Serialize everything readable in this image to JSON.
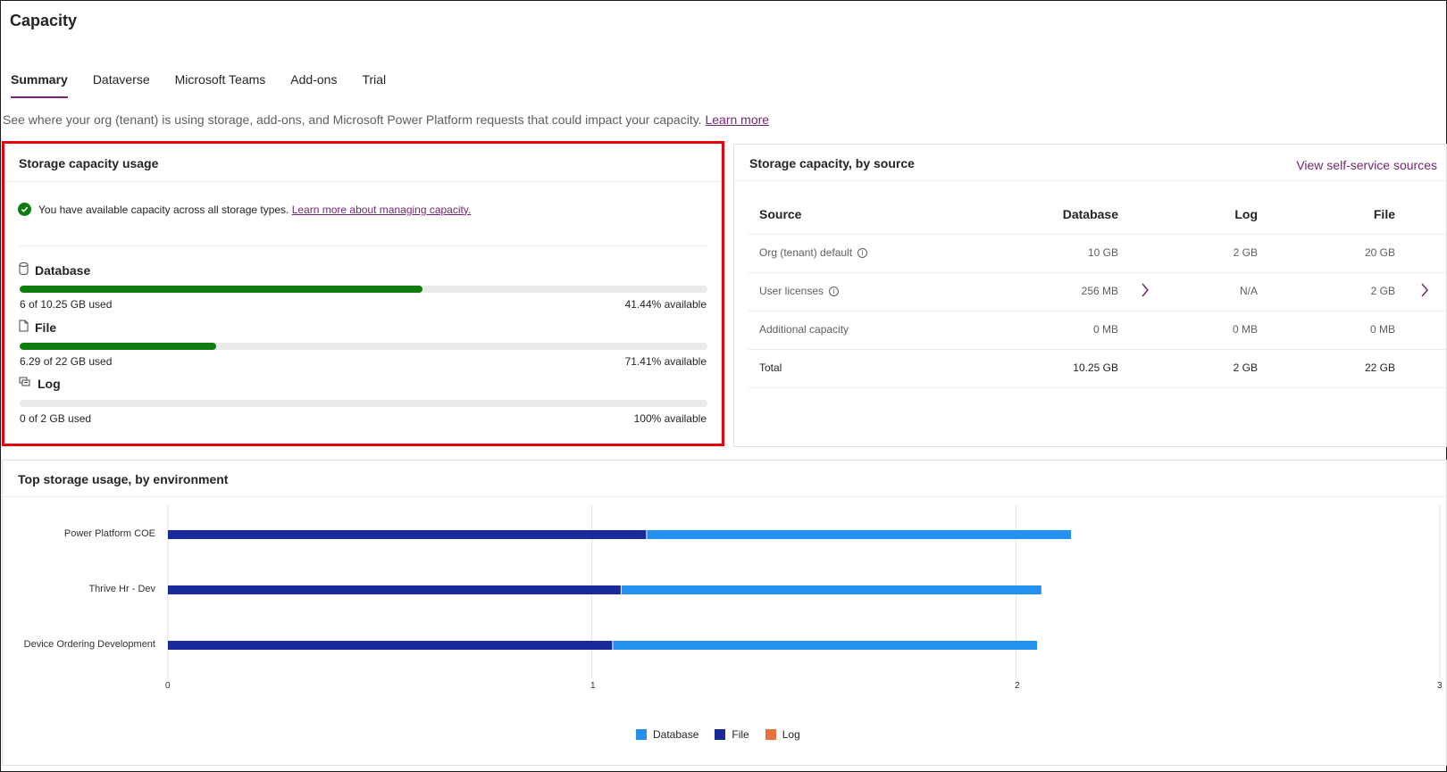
{
  "page": {
    "title": "Capacity"
  },
  "tabs": [
    {
      "label": "Summary",
      "active": true
    },
    {
      "label": "Dataverse"
    },
    {
      "label": "Microsoft Teams"
    },
    {
      "label": "Add-ons"
    },
    {
      "label": "Trial"
    }
  ],
  "description": {
    "text": "See where your org (tenant) is using storage, add-ons, and Microsoft Power Platform requests that could impact your capacity.",
    "link": "Learn more"
  },
  "storage_usage": {
    "title": "Storage capacity usage",
    "status_text": "You have available capacity across all storage types.",
    "status_link": "Learn more about managing capacity.",
    "meters": [
      {
        "name": "Database",
        "icon": "database-icon",
        "used": "6 of 10.25 GB used",
        "available": "41.44% available",
        "fraction": 0.5856
      },
      {
        "name": "File",
        "icon": "file-icon",
        "used": "6.29 of 22 GB used",
        "available": "71.41% available",
        "fraction": 0.2859
      },
      {
        "name": "Log",
        "icon": "log-icon",
        "used": "0 of 2 GB used",
        "available": "100% available",
        "fraction": 0
      }
    ],
    "highlight_color": "#e8000d",
    "meter_color": "#107c10"
  },
  "storage_by_source": {
    "title": "Storage capacity, by source",
    "link": "View self-service sources",
    "headers": [
      "Source",
      "Database",
      "Log",
      "File"
    ],
    "rows": [
      {
        "source": "Org (tenant) default",
        "info": true,
        "database": "10 GB",
        "log": "2 GB",
        "file": "20 GB"
      },
      {
        "source": "User licenses",
        "info": true,
        "database": "256 MB",
        "log": "N/A",
        "file": "2 GB",
        "chevrons": true
      },
      {
        "source": "Additional capacity",
        "database": "0 MB",
        "log": "0 MB",
        "file": "0 MB"
      },
      {
        "source": "Total",
        "database": "10.25 GB",
        "log": "2 GB",
        "file": "22 GB",
        "bold": true
      }
    ]
  },
  "top_usage": {
    "title": "Top storage usage, by environment"
  },
  "chart_data": {
    "type": "bar",
    "orientation": "horizontal",
    "stacked": true,
    "categories": [
      "Power Platform COE",
      "Thrive Hr - Dev",
      "Device Ordering Development"
    ],
    "series": [
      {
        "name": "File",
        "color": "#1b2a9b",
        "values": [
          1.13,
          1.07,
          1.05
        ]
      },
      {
        "name": "Database",
        "color": "#2490f0",
        "values": [
          1.0,
          0.99,
          1.0
        ]
      },
      {
        "name": "Log",
        "color": "#e8703a",
        "values": [
          0,
          0,
          0
        ]
      }
    ],
    "x_ticks": [
      "0",
      "1",
      "2",
      "3"
    ],
    "xlim": [
      0,
      3
    ],
    "legend": [
      {
        "name": "Database",
        "color": "#2490f0"
      },
      {
        "name": "File",
        "color": "#1b2a9b"
      },
      {
        "name": "Log",
        "color": "#e8703a"
      }
    ],
    "legend_position": "bottom",
    "grid": true
  }
}
